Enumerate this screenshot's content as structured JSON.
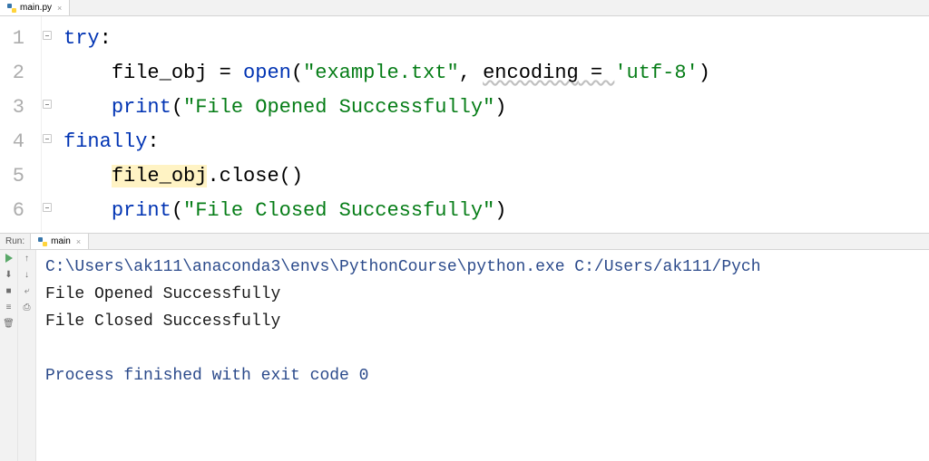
{
  "editor": {
    "tab": {
      "filename": "main.py"
    },
    "lines": [
      "1",
      "2",
      "3",
      "4",
      "5",
      "6"
    ],
    "code": {
      "try_kw": "try",
      "var_file_obj": "file_obj",
      "open_fn": "open",
      "filename_str": "\"example.txt\"",
      "encoding_kw": "encoding",
      "encoding_val": "'utf-8'",
      "print_fn": "print",
      "opened_str": "\"File Opened Successfully\"",
      "finally_kw": "finally",
      "close_method": "close",
      "closed_str": "\"File Closed Successfully\""
    }
  },
  "run": {
    "label": "Run:",
    "tab": "main",
    "console": {
      "cmd": "C:\\Users\\ak111\\anaconda3\\envs\\PythonCourse\\python.exe C:/Users/ak111/Pych",
      "out1": "File Opened Successfully",
      "out2": "File Closed Successfully",
      "exit": "Process finished with exit code 0"
    }
  }
}
